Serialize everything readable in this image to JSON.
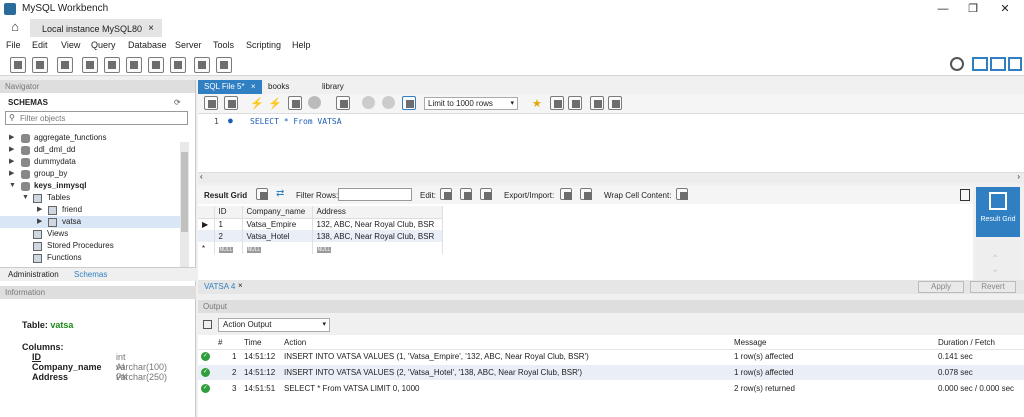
{
  "window": {
    "title": "MySQL Workbench"
  },
  "connection_tab": {
    "label": "Local instance MySQL80",
    "close": "×"
  },
  "menu": [
    "File",
    "Edit",
    "View",
    "Query",
    "Database",
    "Server",
    "Tools",
    "Scripting",
    "Help"
  ],
  "navigator": {
    "header": "Navigator",
    "schemas_label": "SCHEMAS",
    "filter_placeholder": "Filter objects",
    "tree": [
      {
        "label": "aggregate_functions",
        "level": 0,
        "type": "db",
        "expanded": false
      },
      {
        "label": "ddl_dml_dd",
        "level": 0,
        "type": "db",
        "expanded": false
      },
      {
        "label": "dummydata",
        "level": 0,
        "type": "db",
        "expanded": false
      },
      {
        "label": "group_by",
        "level": 0,
        "type": "db",
        "expanded": false
      },
      {
        "label": "keys_inmysql",
        "level": 0,
        "type": "db",
        "expanded": true,
        "bold": true
      },
      {
        "label": "Tables",
        "level": 1,
        "type": "folder",
        "expanded": true
      },
      {
        "label": "friend",
        "level": 2,
        "type": "table",
        "expanded": false
      },
      {
        "label": "vatsa",
        "level": 2,
        "type": "table",
        "expanded": false,
        "selected": true
      },
      {
        "label": "Views",
        "level": 1,
        "type": "folder"
      },
      {
        "label": "Stored Procedures",
        "level": 1,
        "type": "folder"
      },
      {
        "label": "Functions",
        "level": 1,
        "type": "folder"
      }
    ],
    "bottom_tabs": [
      "Administration",
      "Schemas"
    ]
  },
  "information": {
    "header": "Information",
    "table_label": "Table:",
    "table_name": "vatsa",
    "columns_label": "Columns:",
    "columns": [
      {
        "name": "ID",
        "type": "int AI PK"
      },
      {
        "name": "Company_name",
        "type": "varchar(100)"
      },
      {
        "name": "Address",
        "type": "varchar(250)"
      }
    ]
  },
  "editor": {
    "tabs": [
      "SQL File 5*",
      "books",
      "library"
    ],
    "limit_select": "Limit to 1000 rows",
    "line_number": "1",
    "code": "SELECT * From VATSA"
  },
  "result_grid": {
    "label": "Result Grid",
    "filter_label": "Filter Rows:",
    "edit_label": "Edit:",
    "export_label": "Export/Import:",
    "wrap_label": "Wrap Cell Content:",
    "columns": [
      "ID",
      "Company_name",
      "Address"
    ],
    "rows": [
      [
        "1",
        "Vatsa_Empire",
        "132, ABC, Near Royal Club, BSR"
      ],
      [
        "2",
        "Vatsa_Hotel",
        "138, ABC, Near Royal Club, BSR"
      ]
    ],
    "null_label": "NULL",
    "side_button": "Result Grid"
  },
  "result_tabs": {
    "tab": "VATSA 4",
    "apply": "Apply",
    "revert": "Revert"
  },
  "output": {
    "header": "Output",
    "selector": "Action Output",
    "columns": [
      "#",
      "Time",
      "Action",
      "Message",
      "Duration / Fetch"
    ],
    "rows": [
      {
        "num": "1",
        "time": "14:51:12",
        "action": "INSERT INTO VATSA VALUES (1, 'Vatsa_Empire', '132, ABC, Near Royal Club, BSR')",
        "message": "1 row(s) affected",
        "duration": "0.141 sec"
      },
      {
        "num": "2",
        "time": "14:51:12",
        "action": "INSERT INTO VATSA VALUES (2, 'Vatsa_Hotel', '138, ABC, Near Royal Club, BSR')",
        "message": "1 row(s) affected",
        "duration": "0.078 sec"
      },
      {
        "num": "3",
        "time": "14:51:51",
        "action": "SELECT * From VATSA LIMIT 0, 1000",
        "message": "2 row(s) returned",
        "duration": "0.000 sec / 0.000 sec"
      }
    ]
  },
  "colors": {
    "accent": "#2f7fc2",
    "success": "#2d9e3a",
    "keyword": "#1e5db4"
  }
}
